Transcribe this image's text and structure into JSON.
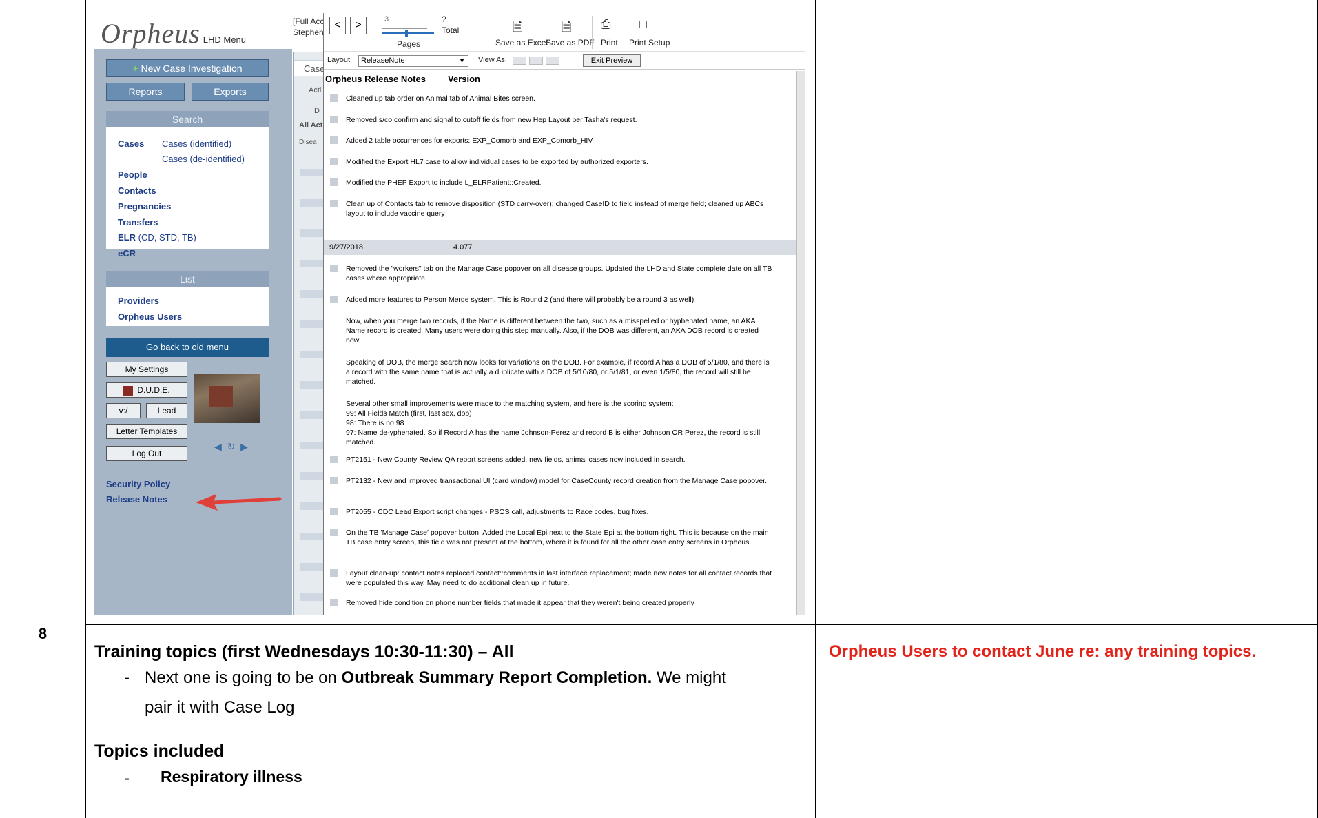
{
  "document": {
    "row_number": "8",
    "topic_title": "Training topics (first Wednesdays 10:30-11:30) – All",
    "note_dash": "-",
    "note_prefix": "Next one is going to be on ",
    "note_bold": "Outbreak Summary Report Completion.",
    "note_suffix": " We might",
    "note_line2": "pair it with Case Log",
    "topics_heading": "Topics included",
    "topic_dash": "-",
    "topic_item": "Respiratory illness",
    "action_item": "Orpheus Users to contact June re: any training topics."
  },
  "app": {
    "logo_text": "Orpheus",
    "logo_sub": "LHD Menu",
    "top_info_line1": "[Full Acc",
    "top_info_line2": "Stephen",
    "new_case_button": "New Case Investigation",
    "reports_button": "Reports",
    "exports_button": "Exports",
    "search_heading": "Search",
    "cases_label": "Cases",
    "cases_identified": "Cases (identified)",
    "cases_deidentified": "Cases (de-identified)",
    "people": "People",
    "contacts": "Contacts",
    "pregnancies": "Pregnancies",
    "transfers": "Transfers",
    "elr": "ELR",
    "elr_suffix": "(CD, STD, TB)",
    "ecr": "eCR",
    "list_heading": "List",
    "providers": "Providers",
    "orpheus_users": "Orpheus Users",
    "go_back": "Go back to old menu",
    "my_settings": "My Settings",
    "dude": "D.U.D.E.",
    "v_button": "v:/",
    "lead_button": "Lead",
    "letter_templates": "Letter Templates",
    "log_out": "Log Out",
    "security_policy": "Security Policy",
    "release_notes": "Release Notes",
    "mid_tab": "Case",
    "mid_stub1": "Acti",
    "mid_stub2": "D",
    "mid_stub3": "All Act",
    "mid_stub4": "Disea"
  },
  "preview": {
    "prev": "<",
    "next": ">",
    "page_value": "3",
    "total_value": "?",
    "total_label": "Total",
    "pages_label": "Pages",
    "save_excel": "Save as Excel",
    "save_pdf": "Save as PDF",
    "print": "Print",
    "print_setup": "Print Setup",
    "layout_label": "Layout:",
    "layout_value": "ReleaseNote",
    "view_as": "View As:",
    "exit_preview": "Exit Preview",
    "col1": "Orpheus Release Notes",
    "col2": "Version",
    "date": "9/27/2018",
    "version": "4.077",
    "items": [
      "Cleaned up tab order on Animal tab of Animal Bites screen.",
      "Removed s/co confirm and signal to cutoff fields from new Hep Layout per Tasha's request.",
      "Added 2 table occurrences for exports: EXP_Comorb and EXP_Comorb_HIV",
      "Modified the Export HL7 case to allow individual cases to be exported by authorized exporters.",
      "Modified the PHEP Export to include L_ELRPatient::Created.",
      "Clean up of Contacts tab to remove disposition (STD carry-over); changed CaseID to field instead of merge field; cleaned up ABCs layout to include vaccine query",
      "Removed the \"workers\" tab on the Manage Case popover on all disease groups. Updated the LHD and State complete date on all TB cases where appropriate.",
      "Added more features to Person Merge system. This is Round 2 (and there will probably be a round 3 as well)",
      "Now, when you merge two records, if the Name is different between the two, such as a misspelled or hyphenated name, an AKA Name record is created. Many users were doing this step manually. Also, if the DOB was different, an AKA DOB record is created now.",
      "Speaking of DOB, the merge search now looks for variations on the DOB. For example, if record A has a DOB of 5/1/80, and there is a record with the same name that is actually a duplicate with a DOB of 5/10/80, or 5/1/81, or even 1/5/80, the record will still be matched.",
      "Several other small improvements were made to the matching system, and here is the scoring system:",
      "99: All Fields Match (first, last sex, dob)",
      "98: There is no 98",
      "97: Name de-yphenated. So if Record A has the name Johnson-Perez and record B is either Johnson OR Perez, the record is still matched.",
      "PT2151 - New County Review QA report screens added, new fields, animal cases now included in search.",
      "PT2132 - New and improved transactional UI (card window) model for CaseCounty record creation from the Manage Case popover.",
      "PT2055 - CDC Lead Export script changes - PSOS call, adjustments to Race codes, bug fixes.",
      "On the TB 'Manage Case' popover button, Added the Local Epi next to the State Epi at the bottom right. This is because on the main TB case entry screen, this field was not present at the bottom, where it is found for all the other case entry screens in Orpheus.",
      "Layout clean-up: contact notes replaced contact::comments in last interface replacement; made new notes for all contact records that were populated this way. May need to do additional clean up in future.",
      "Removed hide condition on phone number fields that made it appear that they weren't being created properly"
    ]
  },
  "colors": {
    "action_red": "#e2231a",
    "sidebar": "#a7b6c7",
    "link_blue": "#1d3d86",
    "arrow_red": "#e0403a"
  }
}
